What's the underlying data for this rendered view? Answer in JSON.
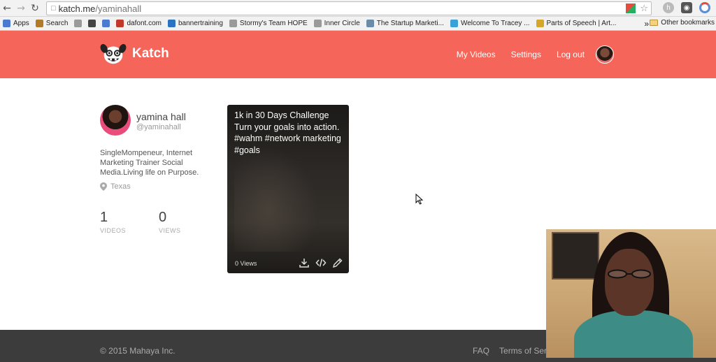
{
  "browser": {
    "url_host": "katch.me",
    "url_path": "/yaminahall",
    "bookmarks": [
      {
        "label": "Apps",
        "color": "#4a7bd0"
      },
      {
        "label": "Search",
        "color": "#b07a2a"
      },
      {
        "label": "",
        "color": "#9a9a9a"
      },
      {
        "label": "",
        "color": "#444444"
      },
      {
        "label": "",
        "color": "#4a7bd0"
      },
      {
        "label": "dafont.com",
        "color": "#c0392b"
      },
      {
        "label": "bannertraining",
        "color": "#2a73c2"
      },
      {
        "label": "Stormy's Team HOPE",
        "color": "#9a9a9a"
      },
      {
        "label": "Inner Circle",
        "color": "#9a9a9a"
      },
      {
        "label": "The Startup Marketi...",
        "color": "#6b8ca8"
      },
      {
        "label": "Welcome To Tracey ...",
        "color": "#3aa0d8"
      },
      {
        "label": "Parts of Speech | Art...",
        "color": "#d4a62a"
      }
    ],
    "overflow": "»",
    "other_bookmarks": "Other bookmarks"
  },
  "header": {
    "brand": "Katch",
    "nav": [
      "My Videos",
      "Settings",
      "Log out"
    ],
    "brand_color": "#f5655a"
  },
  "profile": {
    "name": "yamina hall",
    "handle": "@yaminahall",
    "bio": "SingleMompeneur, Internet Marketing Trainer Social Media.Living life on Purpose.",
    "location": "Texas",
    "videos_count": "1",
    "videos_label": "VIDEOS",
    "views_count": "0",
    "views_label": "VIEWS"
  },
  "video_card": {
    "title": "1k in 30 Days Challenge Turn your goals into action. #wahm #network marketing #goals",
    "views": "0 Views",
    "actions": [
      "download-icon",
      "embed-code-icon",
      "edit-pencil-icon"
    ]
  },
  "footer": {
    "copyright": "© 2015 Mahaya Inc.",
    "links": [
      "FAQ",
      "Terms of Serv"
    ]
  }
}
